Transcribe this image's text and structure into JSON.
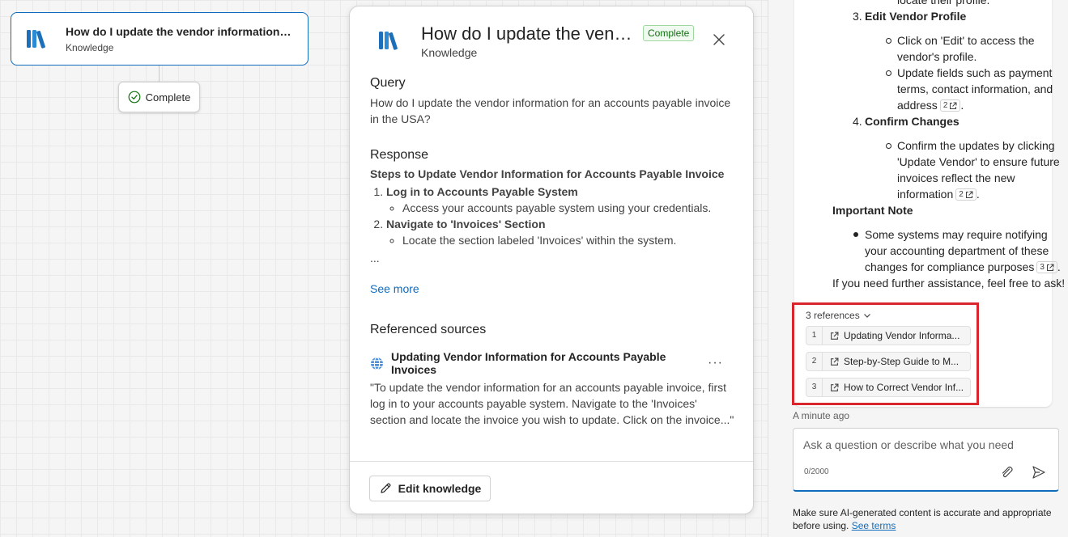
{
  "node": {
    "title": "How do I update the vendor information f...",
    "subtitle": "Knowledge"
  },
  "status_pill": {
    "label": "Complete"
  },
  "panel": {
    "title": "How do I update the vendo...",
    "badge": "Complete",
    "subtitle": "Knowledge",
    "query_heading": "Query",
    "query_text": "How do I update the vendor information for an accounts payable invoice in the USA?",
    "response_heading": "Response",
    "response_title": "Steps to Update Vendor Information for Accounts Payable Invoice",
    "steps": [
      {
        "title": "Log in to Accounts Payable System",
        "detail": "Access your accounts payable system using your credentials."
      },
      {
        "title": "Navigate to 'Invoices' Section",
        "detail": "Locate the section labeled 'Invoices' within the system."
      }
    ],
    "ellipsis": "...",
    "see_more": "See more",
    "sources_heading": "Referenced sources",
    "source_title": "Updating Vendor Information for Accounts Payable Invoices",
    "source_more": "···",
    "source_quote": "\"To update the vendor information for an accounts payable invoice, first log in to your accounts payable system. Navigate to the 'Invoices' section and locate the invoice you wish to update. Click on the invoice...\"",
    "edit_button": "Edit knowledge"
  },
  "chat": {
    "lines": {
      "l1": "locate their profile.",
      "step3_num": "3.",
      "step3": "Edit Vendor Profile",
      "b1a": "Click on 'Edit' to access the",
      "b1b": "vendor's profile.",
      "b2a": "Update fields such as payment",
      "b2b": "terms, contact information, and",
      "b2c": "address",
      "step4_num": "4.",
      "step4": "Confirm Changes",
      "b3a": "Confirm the updates by clicking",
      "b3b": "'Update Vendor' to ensure future",
      "b3c": "invoices reflect the new",
      "b3d": "information",
      "note": "Important Note",
      "n1a": "Some systems may require notifying",
      "n1b": "your accounting department of these",
      "n1c": "changes for compliance purposes",
      "closing": "If you need further assistance, feel free to ask!"
    },
    "citations": {
      "c1": "2",
      "c2": "2",
      "c3": "3"
    },
    "period": ".",
    "references_toggle": "3 references",
    "references": [
      {
        "num": "1",
        "label": "Updating Vendor Informa..."
      },
      {
        "num": "2",
        "label": "Step-by-Step Guide to M..."
      },
      {
        "num": "3",
        "label": "How to Correct Vendor Inf..."
      }
    ],
    "timestamp": "A minute ago",
    "input_placeholder": "Ask a question or describe what you need",
    "char_count": "0/2000",
    "disclaimer": "Make sure AI-generated content is accurate and appropriate before using.",
    "see_terms": "See terms"
  },
  "colors": {
    "accent": "#0f6cbd",
    "success": "#0e700e",
    "highlight": "#d9262c"
  }
}
